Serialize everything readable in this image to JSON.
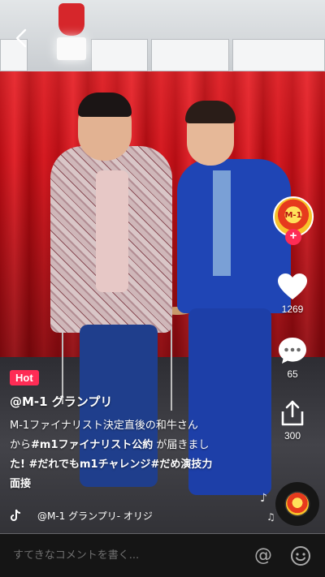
{
  "badge": "Hot",
  "author": "@M-1 グランプリ",
  "caption": {
    "line1": "M-1ファイナリスト決定直後の和牛さん",
    "line2_pre": "から",
    "line2_tag": "#m1ファイナリスト公約",
    "line2_post": " が届きまし",
    "line3_pre": "た! ",
    "line3_tag1": "#だれでもm1チャレンジ",
    "line3_tag2": "#だめ演技力",
    "line4": "面接"
  },
  "sound": "@M-1 グランプリ- オリジ",
  "avatar_text": "M-1",
  "likes": "1269",
  "comments": "65",
  "shares": "300",
  "comment_placeholder": "すてきなコメントを書く...",
  "mention_symbol": "@",
  "colors": {
    "accent": "#fe2c55",
    "curtain": "#c3141b",
    "suit_blue": "#1f45b5"
  },
  "icons": [
    "back-icon",
    "plus-icon",
    "heart-icon",
    "comment-icon",
    "share-icon",
    "tiktok-note-icon",
    "music-note-icon",
    "emoji-icon"
  ]
}
